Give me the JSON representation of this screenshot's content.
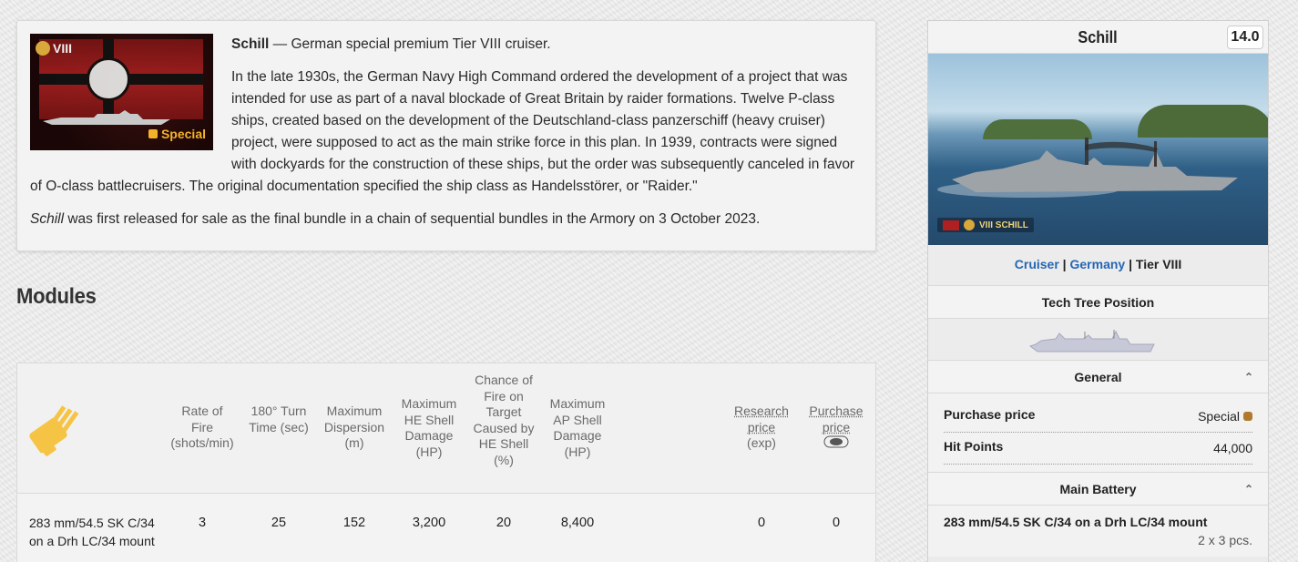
{
  "intro": {
    "banner_tier": "VIII",
    "banner_special": "Special",
    "ship_name": "Schill",
    "summary": " — German special premium Tier VIII cruiser.",
    "history": "In the late 1930s, the German Navy High Command ordered the development of a project that was intended for use as part of a naval blockade of Great Britain by raider formations. Twelve P-class ships, created based on the development of the Deutschland-class panzerschiff (heavy cruiser) project, were supposed to act as the main strike force in this plan. In 1939, contracts were signed with dockyards for the construction of these ships, but the order was subsequently canceled in favor of O-class battlecruisers. The original documentation specified the ship class as Handelsstörer, or \"Raider.\"",
    "release_name": "Schill",
    "release_text": " was first released for sale as the final bundle in a chain of sequential bundles in the Armory on 3 October 2023."
  },
  "modules": {
    "heading": "Modules",
    "columns": {
      "rate_of_fire": "Rate of Fire (shots/min)",
      "turn_time": "180° Turn Time (sec)",
      "max_dispersion": "Maximum Dispersion (m)",
      "max_he_damage": "Maximum HE Shell Damage (HP)",
      "fire_chance": "Chance of Fire on Target Caused by HE Shell (%)",
      "max_ap_damage": "Maximum AP Shell Damage (HP)",
      "research_price": "Research price",
      "research_unit": "(exp)",
      "purchase_price": "Purchase price"
    },
    "rows": [
      {
        "name": "283 mm/54.5 SK C/34 on a Drh LC/34 mount",
        "rate_of_fire": "3",
        "turn_time": "25",
        "max_dispersion": "152",
        "max_he_damage": "3,200",
        "fire_chance": "20",
        "max_ap_damage": "8,400",
        "research_price": "0",
        "purchase_price": "0"
      }
    ]
  },
  "infobox": {
    "title": "Schill",
    "rating": "14.0",
    "image_label": "VIII SCHILL",
    "class_link": "Cruiser",
    "nation_link": "Germany",
    "tier": "Tier VIII",
    "sep": " | ",
    "tech_tree_title": "Tech Tree Position",
    "general_title": "General",
    "purchase_price_label": "Purchase price",
    "purchase_price_value": "Special",
    "hit_points_label": "Hit Points",
    "hit_points_value": "44,000",
    "main_battery_title": "Main Battery",
    "main_battery_gun": "283 mm/54.5 SK C/34 on a Drh LC/34 mount",
    "main_battery_qty": "2 x 3 pcs.",
    "accent_link_color": "#2567b3"
  }
}
